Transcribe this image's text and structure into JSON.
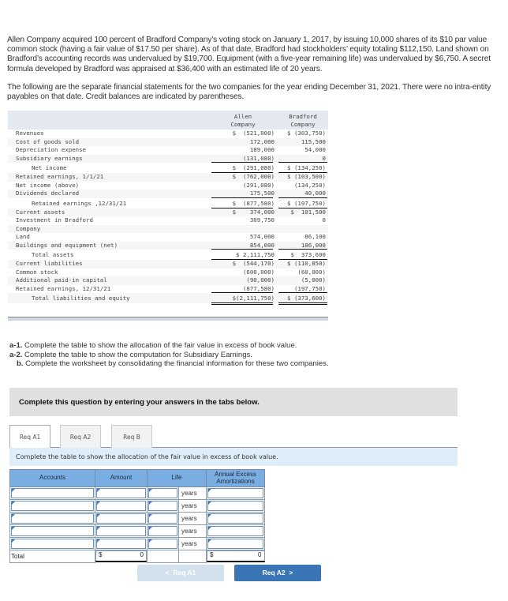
{
  "intro": {
    "paragraph1": "Allen Company acquired 100 percent of Bradford Company’s voting stock on January 1, 2017, by issuing 10,000 shares of its $10 par value common stock (having a fair value of $17.50 per share). As of that date, Bradford had stockholders’ equity totaling $112,150. Land shown on Bradford’s accounting records was undervalued by $19,700. Equipment (with a five-year remaining life) was undervalued by $6,750. A secret formula developed by Bradford was appraised at $36,400 with an estimated life of 20 years.",
    "paragraph2": "The following are the separate financial statements for the two companies for the year ending December 31, 2021. There were no intra-entity payables on that date. Credit balances are indicated by parentheses."
  },
  "financials": {
    "col_allen": "Allen\nCompany",
    "col_bradford": "Bradford\nCompany",
    "rows": [
      {
        "label": "Revenues",
        "allen": "$  (521,000)",
        "bradford": "$ (303,750)"
      },
      {
        "label": "Cost of goods sold",
        "allen": "172,000",
        "bradford": "115,500"
      },
      {
        "label": "Depreciation expense",
        "allen": "189,000",
        "bradford": "54,000"
      },
      {
        "label": "Subsidiary earnings",
        "allen": "(131,080)",
        "bradford": "0"
      },
      {
        "label": "Net income",
        "allen": "$  (291,080)",
        "bradford": "$ (134,250)"
      },
      {
        "label": "Retained earnings, 1/1/21",
        "allen": "$  (762,000)",
        "bradford": "$ (103,500)"
      },
      {
        "label": "Net income (above)",
        "allen": "(291,080)",
        "bradford": "(134,250)"
      },
      {
        "label": "Dividends declared",
        "allen": "175,500",
        "bradford": "40,000"
      },
      {
        "label": "Retained earnings ,12/31/21",
        "allen": "$  (877,580)",
        "bradford": "$ (197,750)"
      },
      {
        "label": "Current assets",
        "allen": "$    374,000",
        "bradford": "$  101,500"
      },
      {
        "label": "Investment in Bradford",
        "allen": "309,750",
        "bradford": "0"
      },
      {
        "label": "Company",
        "allen": "",
        "bradford": ""
      },
      {
        "label": "Land",
        "allen": "574,000",
        "bradford": "86,100"
      },
      {
        "label": "Buildings and equipment (net)",
        "allen": "854,000",
        "bradford": "186,000"
      },
      {
        "label": "Total assets",
        "allen": "$ 2,111,750",
        "bradford": "$  373,600"
      },
      {
        "label": "Current liabilities",
        "allen": "$  (544,170)",
        "bradford": "$ (110,850)"
      },
      {
        "label": "Common stock",
        "allen": "(600,000)",
        "bradford": "(60,000)"
      },
      {
        "label": "Additional paid-in capital",
        "allen": "(90,000)",
        "bradford": "(5,000)"
      },
      {
        "label": "Retained earnings, 12/31/21",
        "allen": "(877,580)",
        "bradford": "(197,750)"
      },
      {
        "label": "Total liabilities and equity",
        "allen": "$(2,111,750)",
        "bradford": "$ (373,600)"
      }
    ]
  },
  "requirements": [
    {
      "tag": "a-1.",
      "text": " Complete the table to show the allocation of the fair value in excess of book value."
    },
    {
      "tag": "a-2.",
      "text": " Complete the table to show the computation for Subsidiary Earnings."
    },
    {
      "tag": "b.",
      "text": " Complete the worksheet by consolidating the financial information for these two companies."
    }
  ],
  "banner": "Complete this question by entering your answers in the tabs below.",
  "tabs": [
    {
      "label": "Req A1",
      "active": true
    },
    {
      "label": "Req A2",
      "active": false
    },
    {
      "label": "Req B",
      "active": false
    }
  ],
  "instruction": "Complete the table to show the allocation of the fair value in excess of book value.",
  "grid": {
    "headers": {
      "accounts": "Accounts",
      "amount": "Amount",
      "life": "Life",
      "annual": "Annual Excess Amortizations"
    },
    "years_label": "years",
    "rows": [
      {
        "account": "",
        "amount": "",
        "life": "",
        "annual": ""
      },
      {
        "account": "",
        "amount": "",
        "life": "",
        "annual": ""
      },
      {
        "account": "",
        "amount": "",
        "life": "",
        "annual": ""
      },
      {
        "account": "",
        "amount": "",
        "life": "",
        "annual": ""
      },
      {
        "account": "",
        "amount": "",
        "life": "",
        "annual": ""
      }
    ],
    "total": {
      "label": "Total",
      "currency": "$",
      "amount": "0",
      "annual": "0"
    }
  },
  "nav": {
    "prev": "Req A1",
    "next": "Req A2"
  }
}
